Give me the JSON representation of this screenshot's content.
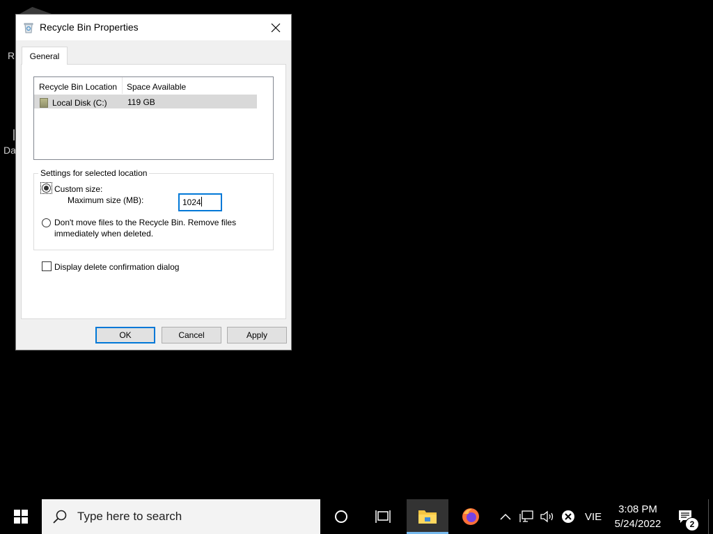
{
  "desktop": {
    "label_r": "R",
    "label_d": "Da"
  },
  "dialog": {
    "title": "Recycle Bin Properties",
    "tab": "General",
    "list": {
      "headers": [
        "Recycle Bin Location",
        "Space Available"
      ],
      "rows": [
        {
          "location": "Local Disk (C:)",
          "space": "119 GB"
        }
      ]
    },
    "settings": {
      "legend": "Settings for selected location",
      "custom_size_label": "Custom size:",
      "max_size_label": "Maximum size (MB):",
      "max_size_value": "1024",
      "dont_move_line1": "Don't move files to the Recycle Bin. Remove files",
      "dont_move_line2": "immediately when deleted.",
      "custom_size_selected": true,
      "dont_move_selected": false
    },
    "confirm_label": "Display delete confirmation dialog",
    "confirm_checked": false,
    "buttons": {
      "ok": "OK",
      "cancel": "Cancel",
      "apply": "Apply"
    }
  },
  "taskbar": {
    "search_placeholder": "Type here to search",
    "language": "VIE",
    "time": "3:08 PM",
    "date": "5/24/2022",
    "notification_count": "2"
  },
  "colors": {
    "accent": "#0078d7",
    "taskbar": "#000000",
    "dialog_bg": "#f0f0f0"
  }
}
